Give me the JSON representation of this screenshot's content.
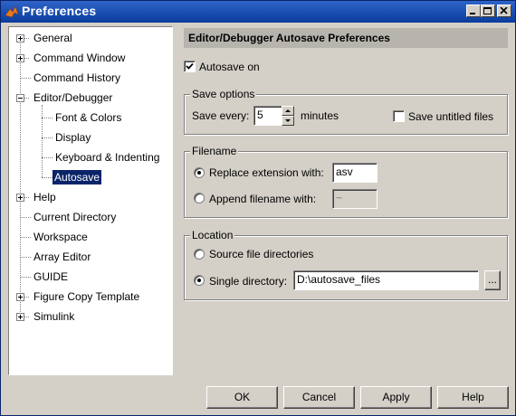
{
  "window": {
    "title": "Preferences"
  },
  "tree": {
    "items": [
      {
        "label": "General"
      },
      {
        "label": "Command Window"
      },
      {
        "label": "Command History"
      },
      {
        "label": "Editor/Debugger"
      },
      {
        "label": "Font & Colors"
      },
      {
        "label": "Display"
      },
      {
        "label": "Keyboard & Indenting"
      },
      {
        "label": "Autosave",
        "selected": true
      },
      {
        "label": "Help"
      },
      {
        "label": "Current Directory"
      },
      {
        "label": "Workspace"
      },
      {
        "label": "Array Editor"
      },
      {
        "label": "GUIDE"
      },
      {
        "label": "Figure Copy Template"
      },
      {
        "label": "Simulink"
      }
    ]
  },
  "panel": {
    "title": "Editor/Debugger Autosave Preferences",
    "autosave_label": "Autosave on",
    "autosave_checked": true,
    "save_options": {
      "legend": "Save options",
      "save_every_label": "Save every:",
      "save_every_value": "5",
      "minutes_label": "minutes",
      "save_untitled_label": "Save untitled files",
      "save_untitled_checked": false
    },
    "filename": {
      "legend": "Filename",
      "replace_label": "Replace extension with:",
      "replace_value": "asv",
      "append_label": "Append filename with:",
      "append_value": "~",
      "selected": "replace"
    },
    "location": {
      "legend": "Location",
      "source_label": "Source file directories",
      "single_label": "Single directory:",
      "single_value": "D:\\autosave_files",
      "browse_label": "...",
      "selected": "single"
    }
  },
  "buttons": {
    "ok": "OK",
    "cancel": "Cancel",
    "apply": "Apply",
    "help": "Help"
  },
  "colors": {
    "title_bar": "#0a3c9c",
    "selection": "#0a246a",
    "face": "#d4d0c8"
  }
}
